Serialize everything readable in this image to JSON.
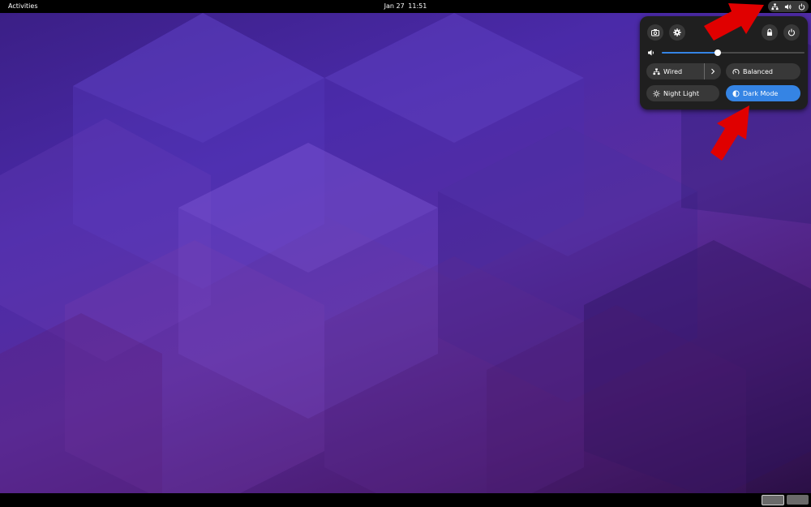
{
  "topbar": {
    "activities_label": "Activities",
    "clock_date": "Jan 27",
    "clock_time": "11:51",
    "tray_icons": [
      "network-wired-icon",
      "volume-icon",
      "power-icon"
    ]
  },
  "quick_settings": {
    "buttons": [
      "camera-icon",
      "gear-icon",
      "lock-icon",
      "power-icon"
    ],
    "volume": {
      "icon": "volume-low-icon",
      "level": 0.39
    },
    "toggles": {
      "wired": {
        "label": "Wired",
        "active": true
      },
      "balanced": {
        "label": "Balanced",
        "active": false
      },
      "night_light": {
        "label": "Night Light",
        "active": false
      },
      "dark_mode": {
        "label": "Dark Mode",
        "active": true
      }
    }
  },
  "colors": {
    "accent": "#3584e4",
    "panel": "#1f1f1f",
    "button": "#383838",
    "annotation_arrow": "#e00000"
  },
  "workspaces": [
    {
      "active": true
    },
    {
      "active": false
    }
  ]
}
